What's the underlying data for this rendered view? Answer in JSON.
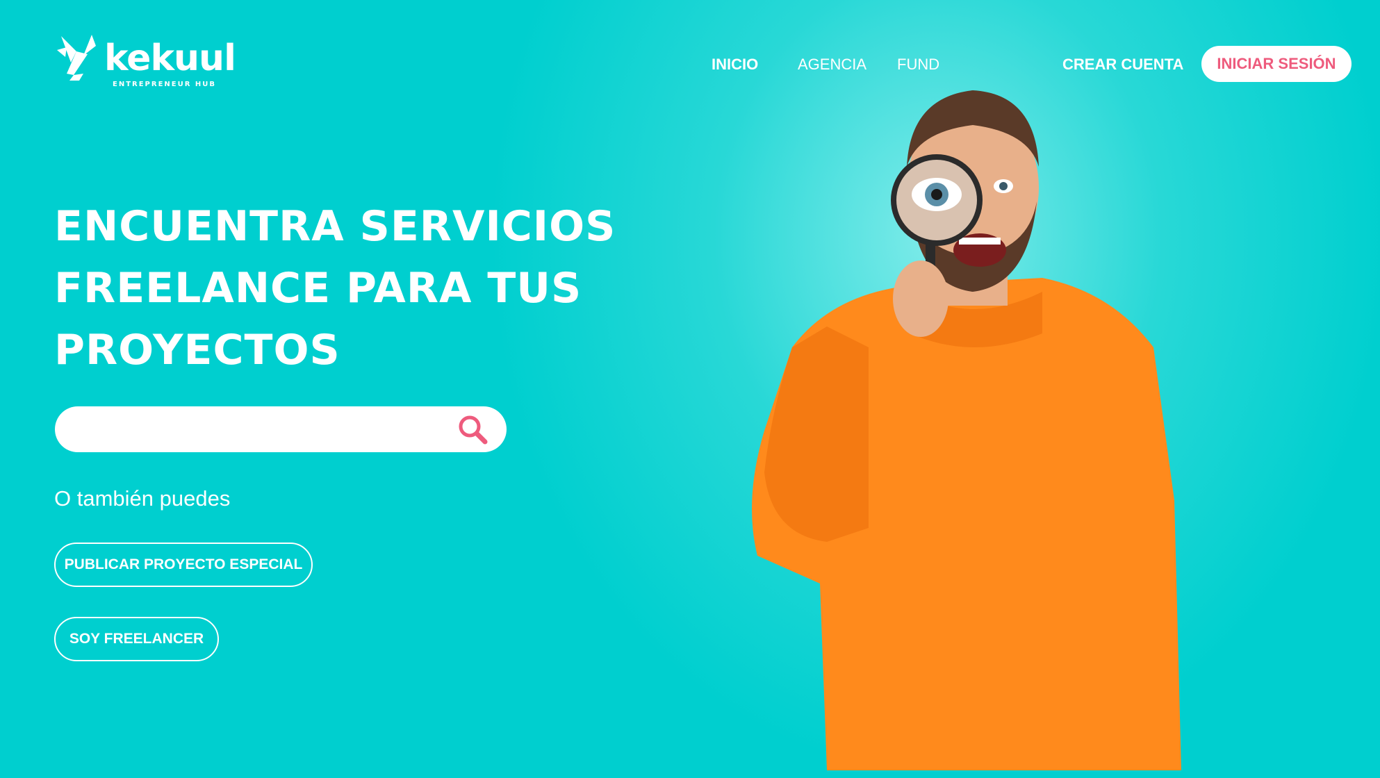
{
  "brand": {
    "name": "kekuul",
    "tagline": "ENTREPRENEUR HUB",
    "logo_icon": "bird-logo-icon",
    "colors": {
      "background": "#00cfcf",
      "accent": "#ee5b7d",
      "text": "#ffffff"
    }
  },
  "nav": {
    "items": [
      {
        "label": "INICIO",
        "active": true
      },
      {
        "label": "AGENCIA",
        "active": false
      },
      {
        "label": "FUND",
        "active": false
      }
    ],
    "create_account": "CREAR CUENTA",
    "login": "INICIAR SESIÓN"
  },
  "hero": {
    "title_lines": [
      "ENCUENTRA SERVICIOS",
      "FREELANCE PARA TUS",
      "PROYECTOS"
    ],
    "search": {
      "value": "",
      "placeholder": "",
      "icon": "search-icon"
    },
    "alt_text": "O también puedes",
    "buttons": {
      "publish": "PUBLICAR PROYECTO ESPECIAL",
      "freelancer": "SOY FREELANCER"
    },
    "image": "man-with-magnifying-glass"
  }
}
